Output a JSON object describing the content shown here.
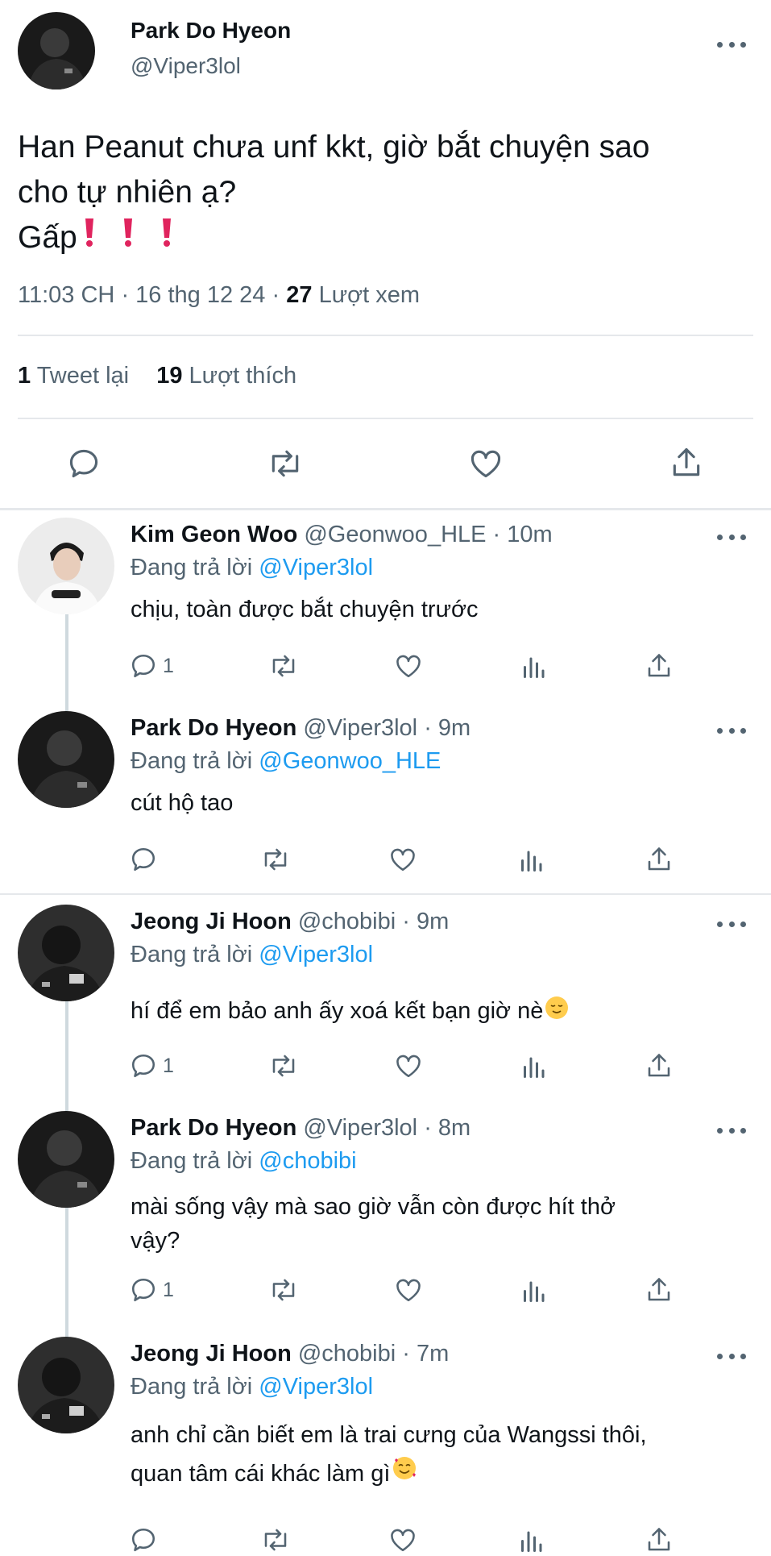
{
  "main_tweet": {
    "author_name": "Park Do Hyeon",
    "handle": "@Viper3lol",
    "text_line1": "Han Peanut chưa unf kkt, giờ bắt chuyện sao",
    "text_line2": "cho tự nhiên ạ?",
    "text_line3": "Gấp",
    "time": "11:03 CH",
    "date": "16 thg 12 24",
    "views_count": "27",
    "views_label": "Lượt xem",
    "retweets_count": "1",
    "retweets_label": "Tweet lại",
    "likes_count": "19",
    "likes_label": "Lượt thích",
    "exclamation_icons": [
      "red-exclamation-icon",
      "red-exclamation-icon",
      "red-exclamation-icon"
    ]
  },
  "reply_prefix": "Đang trả lời",
  "separator": "·",
  "replies": [
    {
      "author_name": "Kim Geon Woo",
      "handle": "@Geonwoo_HLE",
      "time": "10m",
      "replying_to": "@Viper3lol",
      "text_line1": "chịu, toàn được bắt chuyện trước",
      "text_line2": "",
      "reply_count": "1"
    },
    {
      "author_name": "Park Do Hyeon",
      "handle": "@Viper3lol",
      "time": "9m",
      "replying_to": "@Geonwoo_HLE",
      "text_line1": "cút hộ tao",
      "text_line2": "",
      "reply_count": ""
    },
    {
      "author_name": "Jeong Ji Hoon",
      "handle": "@chobibi",
      "time": "9m",
      "replying_to": "@Viper3lol",
      "text_line1": "hí để em bảo anh ấy xoá kết bạn giờ nè",
      "text_line2": "",
      "reply_count": "1",
      "emoji": "relieved-face-emoji"
    },
    {
      "author_name": "Park Do Hyeon",
      "handle": "@Viper3lol",
      "time": "8m",
      "replying_to": "@chobibi",
      "text_line1": "mài sống vậy mà sao giờ vẫn còn được hít thở",
      "text_line2": "vậy?",
      "reply_count": "1"
    },
    {
      "author_name": "Jeong Ji Hoon",
      "handle": "@chobibi",
      "time": "7m",
      "replying_to": "@Viper3lol",
      "text_line1": "anh chỉ cần biết em là trai cưng của Wangssi thôi,",
      "text_line2": "quan tâm cái khác làm gì",
      "reply_count": "",
      "emoji": "smiling-face-with-hearts-emoji"
    }
  ],
  "colors": {
    "link": "#1d9bf0",
    "secondary_text": "#536471",
    "divider": "#e5e8eb",
    "thread_line": "#cfd9de",
    "exclamation": "#e0245e"
  }
}
